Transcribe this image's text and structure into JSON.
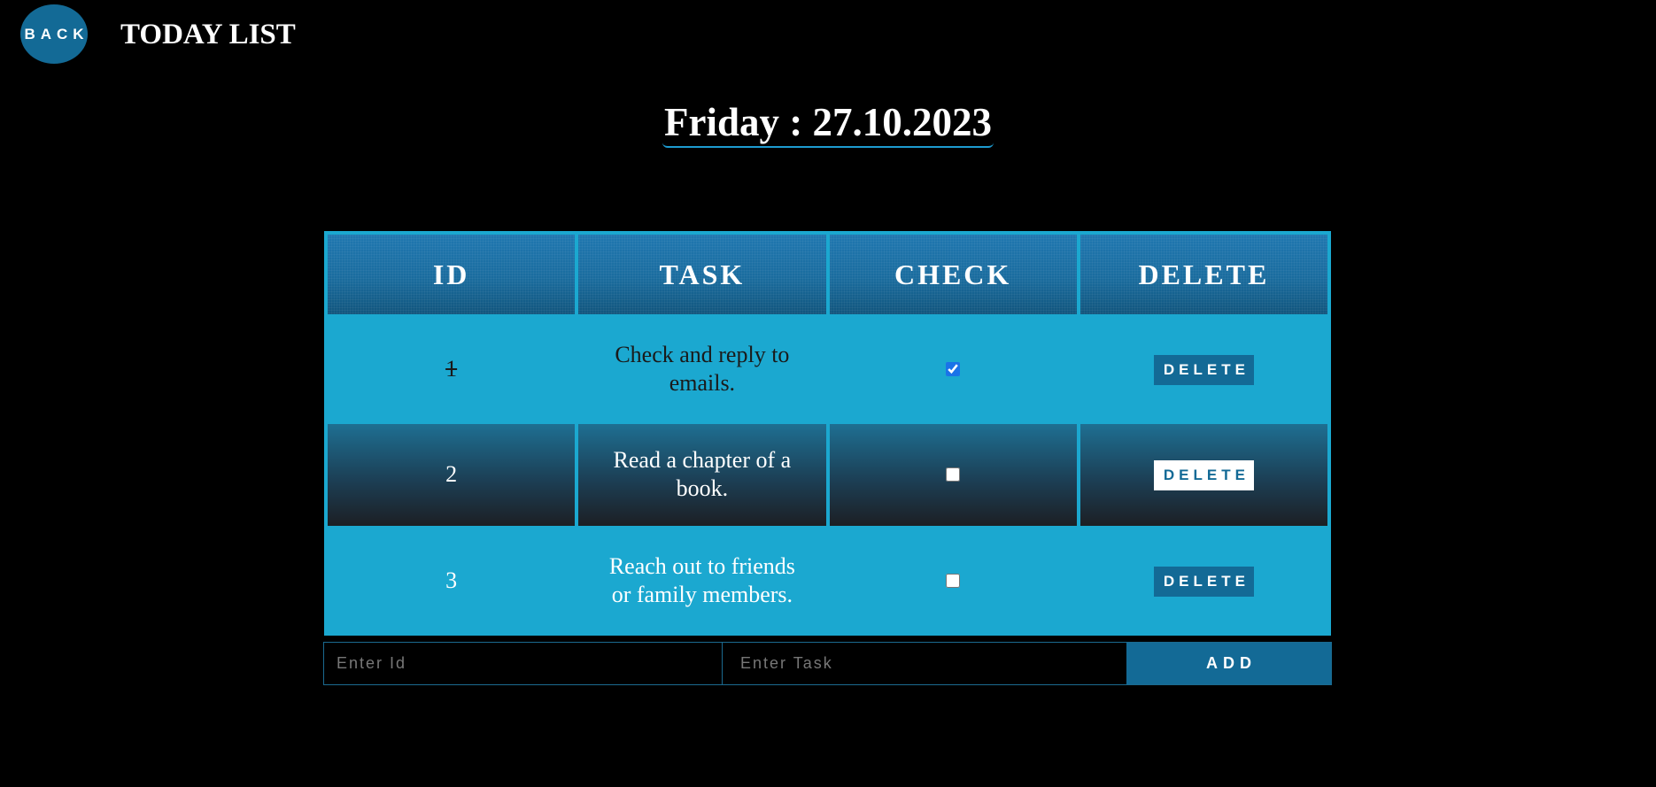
{
  "header": {
    "back_label": "BACK",
    "title": "TODAY LIST"
  },
  "date_heading": "Friday : 27.10.2023",
  "table": {
    "columns": [
      "ID",
      "TASK",
      "CHECK",
      "DELETE"
    ],
    "rows": [
      {
        "id": "1",
        "task": "Check and reply to emails.",
        "checked": true,
        "delete_label": "DELETE"
      },
      {
        "id": "2",
        "task": "Read a chapter of a book.",
        "checked": false,
        "delete_label": "DELETE"
      },
      {
        "id": "3",
        "task": "Reach out to friends or family members.",
        "checked": false,
        "delete_label": "DELETE"
      }
    ]
  },
  "form": {
    "id_placeholder": "Enter Id",
    "task_placeholder": "Enter Task",
    "add_label": "ADD"
  },
  "colors": {
    "accent": "#136a96",
    "table_background": "#1ba8d0",
    "page_background": "#000000"
  }
}
